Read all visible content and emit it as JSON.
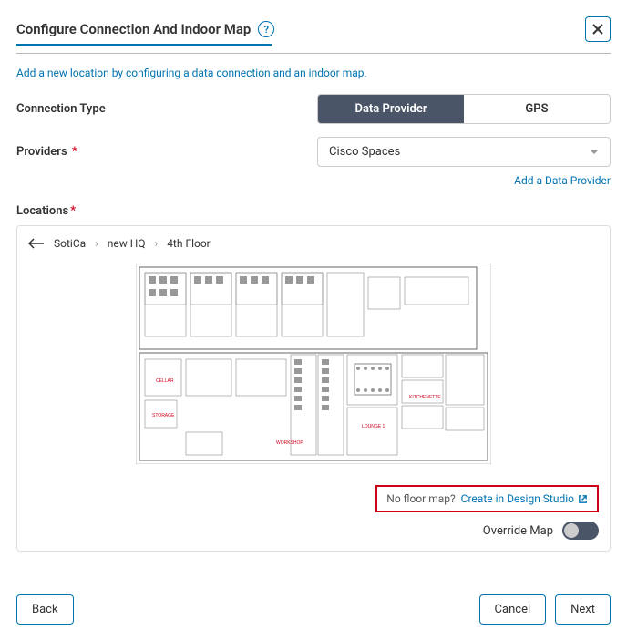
{
  "header": {
    "title": "Configure Connection And Indoor Map"
  },
  "intro_text": "Add a new location by configuring a data connection and an indoor map.",
  "fields": {
    "connection_type": {
      "label": "Connection Type",
      "options": {
        "data_provider": "Data Provider",
        "gps": "GPS"
      }
    },
    "providers": {
      "label": "Providers",
      "value": "Cisco Spaces"
    }
  },
  "links": {
    "add_provider": "Add a Data Provider",
    "no_floor_map": "No floor map?",
    "create_design_studio": "Create in Design Studio"
  },
  "locations": {
    "label": "Locations",
    "breadcrumb": [
      "SotiCa",
      "new HQ",
      "4th Floor"
    ]
  },
  "override_map_label": "Override Map",
  "footer": {
    "back": "Back",
    "cancel": "Cancel",
    "next": "Next"
  }
}
